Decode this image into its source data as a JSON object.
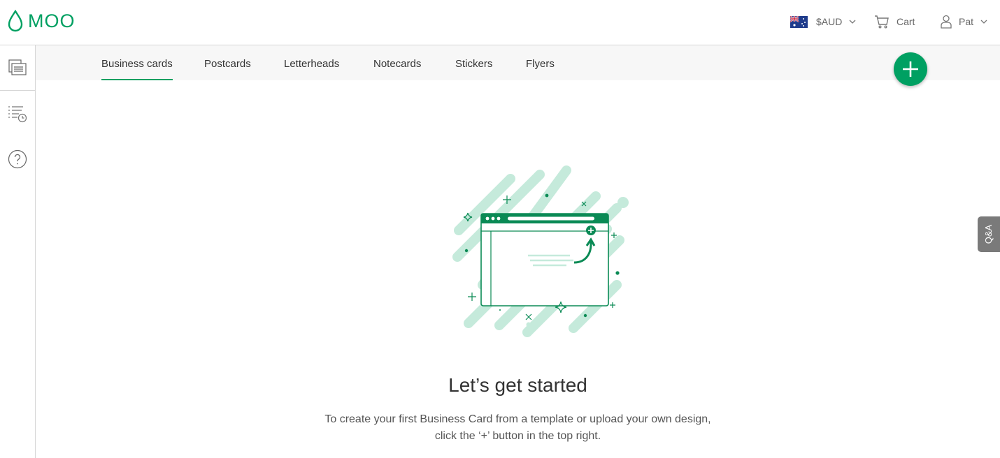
{
  "brand": {
    "name": "MOO",
    "color": "#00a062"
  },
  "header": {
    "currency": {
      "label": "$AUD",
      "flag": "australia-flag-icon"
    },
    "cart_label": "Cart",
    "user_label": "Pat"
  },
  "sidebar": {
    "items": [
      {
        "icon": "designs-icon"
      },
      {
        "icon": "history-list-icon"
      },
      {
        "icon": "help-icon"
      }
    ]
  },
  "tabs": [
    {
      "label": "Business cards",
      "active": true
    },
    {
      "label": "Postcards",
      "active": false
    },
    {
      "label": "Letterheads",
      "active": false
    },
    {
      "label": "Notecards",
      "active": false
    },
    {
      "label": "Stickers",
      "active": false
    },
    {
      "label": "Flyers",
      "active": false
    }
  ],
  "fab": {
    "icon": "plus-icon"
  },
  "qa_tab": {
    "label": "Q&A"
  },
  "empty_state": {
    "title": "Let’s get started",
    "line1": "To create your first Business Card from a template or upload your own design,",
    "line2": "click the ‘+’ button in the top right."
  },
  "colors": {
    "accent": "#00a062",
    "illustration_light": "#c5eadb",
    "tab_bar_bg": "#f7f7f7"
  }
}
